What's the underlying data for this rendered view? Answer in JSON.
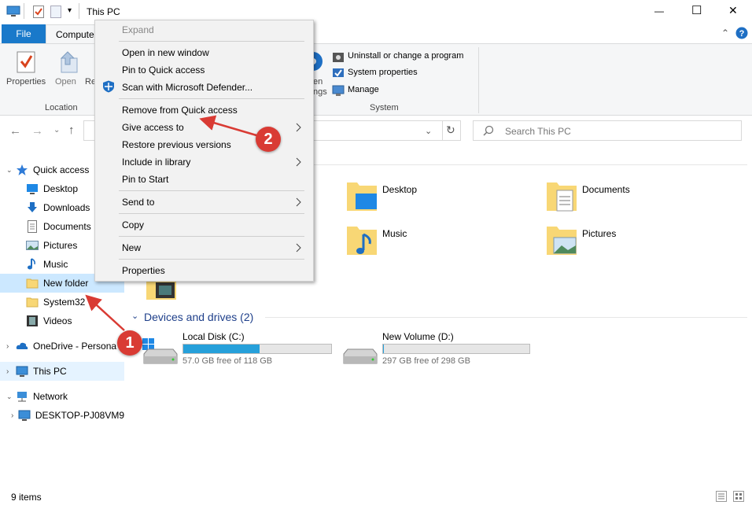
{
  "window": {
    "title": "This PC",
    "minimize": "—",
    "maximize": "☐",
    "close": "✕"
  },
  "ribbon": {
    "tabs": [
      "File",
      "Computer"
    ],
    "location": {
      "group_label": "Location",
      "properties_label": "Properties",
      "open_label": "Open",
      "rename_partial": "Re"
    },
    "open_settings_partial": [
      "en",
      "ngs"
    ],
    "system": {
      "group_label": "System",
      "uninstall_label": "Uninstall or change a program",
      "system_properties_label": "System properties",
      "manage_label": "Manage"
    }
  },
  "address": {
    "search_placeholder": "Search This PC"
  },
  "nav": {
    "quick_access": "Quick access",
    "items": [
      "Desktop",
      "Downloads",
      "Documents",
      "Pictures",
      "Music",
      "New folder",
      "System32",
      "Videos"
    ],
    "onedrive": "OneDrive - Persona",
    "this_pc": "This PC",
    "network": "Network",
    "desktop_pc": "DESKTOP-PJ08VM9"
  },
  "content": {
    "folders": [
      "Desktop",
      "Documents",
      "Music",
      "Pictures"
    ],
    "devices_header": "Devices and drives (2)",
    "drives": [
      {
        "name": "Local Disk (C:)",
        "free": "57.0 GB free of 118 GB",
        "used_fraction": 0.517
      },
      {
        "name": "New Volume (D:)",
        "free": "297 GB free of 298 GB",
        "used_fraction": 0.003
      }
    ]
  },
  "context_menu": {
    "expand": "Expand",
    "open_new_window": "Open in new window",
    "pin_quick_access": "Pin to Quick access",
    "scan_defender": "Scan with Microsoft Defender...",
    "remove_quick_access": "Remove from Quick access",
    "give_access": "Give access to",
    "restore_versions": "Restore previous versions",
    "include_library": "Include in library",
    "pin_start": "Pin to Start",
    "send_to": "Send to",
    "copy": "Copy",
    "new": "New",
    "properties": "Properties"
  },
  "annotations": {
    "badge1": "1",
    "badge2": "2",
    "color": "#d93b34"
  },
  "status": {
    "items": "9 items"
  }
}
